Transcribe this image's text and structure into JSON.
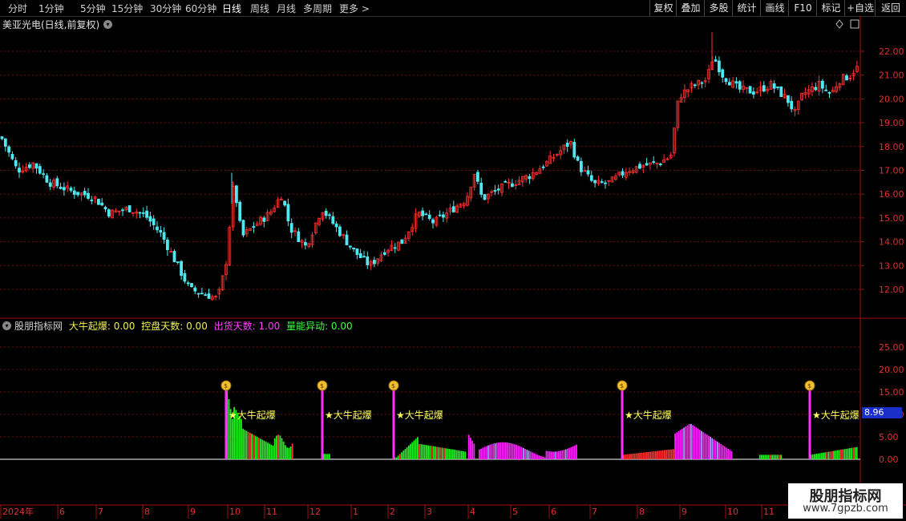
{
  "toolbar": {
    "periods": [
      "分时",
      "1分钟",
      "5分钟",
      "15分钟",
      "30分钟",
      "60分钟",
      "日线",
      "周线",
      "月线",
      "多周期",
      "更多 >"
    ],
    "active_period": "日线",
    "right_buttons": [
      "复权",
      "叠加",
      "多股",
      "统计",
      "画线",
      "F10",
      "标记",
      "+自选",
      "返回"
    ]
  },
  "main_chart": {
    "title": "美亚光电(日线,前复权)",
    "y_ticks": [
      "22.00",
      "21.00",
      "20.00",
      "19.00",
      "18.00",
      "17.00",
      "16.00",
      "15.00",
      "14.00",
      "13.00",
      "12.00"
    ],
    "y_range": [
      11.4,
      22.8
    ]
  },
  "indicator": {
    "name": "股朋指标网",
    "items": [
      {
        "label": "大牛起爆: 0.00",
        "color": "#f0f050"
      },
      {
        "label": "控盘天数: 0.00",
        "color": "#f0f050"
      },
      {
        "label": "出货天数: 1.00",
        "color": "#ff40ff"
      },
      {
        "label": "量能异动: 0.00",
        "color": "#40ff40"
      }
    ],
    "y_ticks": [
      "25.00",
      "20.00",
      "15.00",
      "10.00",
      "5.00",
      "0.00"
    ],
    "current_value": "8.96",
    "signal_label": "★大牛起爆",
    "signal_positions": [
      282,
      402,
      491,
      776,
      1010
    ]
  },
  "x_axis": {
    "labels": [
      "2024年",
      "6",
      "7",
      "8",
      "9",
      "10",
      "11",
      "12",
      "1",
      "2",
      "3",
      "4",
      "5",
      "6",
      "7",
      "8",
      "9",
      "10",
      "11"
    ]
  },
  "watermark": {
    "line1": "股朋指标网",
    "line2": "www.7gpzb.com"
  },
  "chart_data": {
    "type": "candlestick",
    "title": "美亚光电(日线,前复权)",
    "approx_close_path": [
      [
        0,
        18.4
      ],
      [
        20,
        17.0
      ],
      [
        40,
        17.3
      ],
      [
        60,
        16.5
      ],
      [
        90,
        16.1
      ],
      [
        115,
        15.9
      ],
      [
        135,
        15.2
      ],
      [
        160,
        15.4
      ],
      [
        180,
        15.1
      ],
      [
        200,
        14.3
      ],
      [
        220,
        13.0
      ],
      [
        235,
        12.0
      ],
      [
        255,
        11.8
      ],
      [
        270,
        11.6
      ],
      [
        280,
        13.0
      ],
      [
        290,
        16.5
      ],
      [
        300,
        14.2
      ],
      [
        320,
        14.8
      ],
      [
        335,
        15.2
      ],
      [
        350,
        16.0
      ],
      [
        360,
        14.6
      ],
      [
        380,
        13.8
      ],
      [
        400,
        15.4
      ],
      [
        420,
        14.5
      ],
      [
        440,
        13.6
      ],
      [
        460,
        13.0
      ],
      [
        480,
        13.7
      ],
      [
        500,
        14.0
      ],
      [
        520,
        15.2
      ],
      [
        540,
        14.8
      ],
      [
        560,
        15.3
      ],
      [
        580,
        15.8
      ],
      [
        590,
        16.9
      ],
      [
        600,
        15.8
      ],
      [
        620,
        16.2
      ],
      [
        640,
        16.5
      ],
      [
        660,
        16.8
      ],
      [
        680,
        17.3
      ],
      [
        700,
        17.9
      ],
      [
        710,
        18.2
      ],
      [
        720,
        17.2
      ],
      [
        740,
        16.4
      ],
      [
        760,
        16.5
      ],
      [
        780,
        17.0
      ],
      [
        800,
        17.2
      ],
      [
        820,
        17.3
      ],
      [
        835,
        17.6
      ],
      [
        845,
        20.1
      ],
      [
        860,
        20.5
      ],
      [
        880,
        20.8
      ],
      [
        888,
        21.8
      ],
      [
        900,
        21.0
      ],
      [
        920,
        20.4
      ],
      [
        940,
        20.3
      ],
      [
        960,
        20.6
      ],
      [
        980,
        20.0
      ],
      [
        990,
        19.4
      ],
      [
        1000,
        20.2
      ],
      [
        1020,
        20.6
      ],
      [
        1035,
        20.2
      ],
      [
        1045,
        20.8
      ],
      [
        1060,
        21.0
      ],
      [
        1065,
        21.3
      ]
    ],
    "indicator_bars_note": "bars colored green (量能异动) / magenta (出货) / red (控盘)"
  }
}
